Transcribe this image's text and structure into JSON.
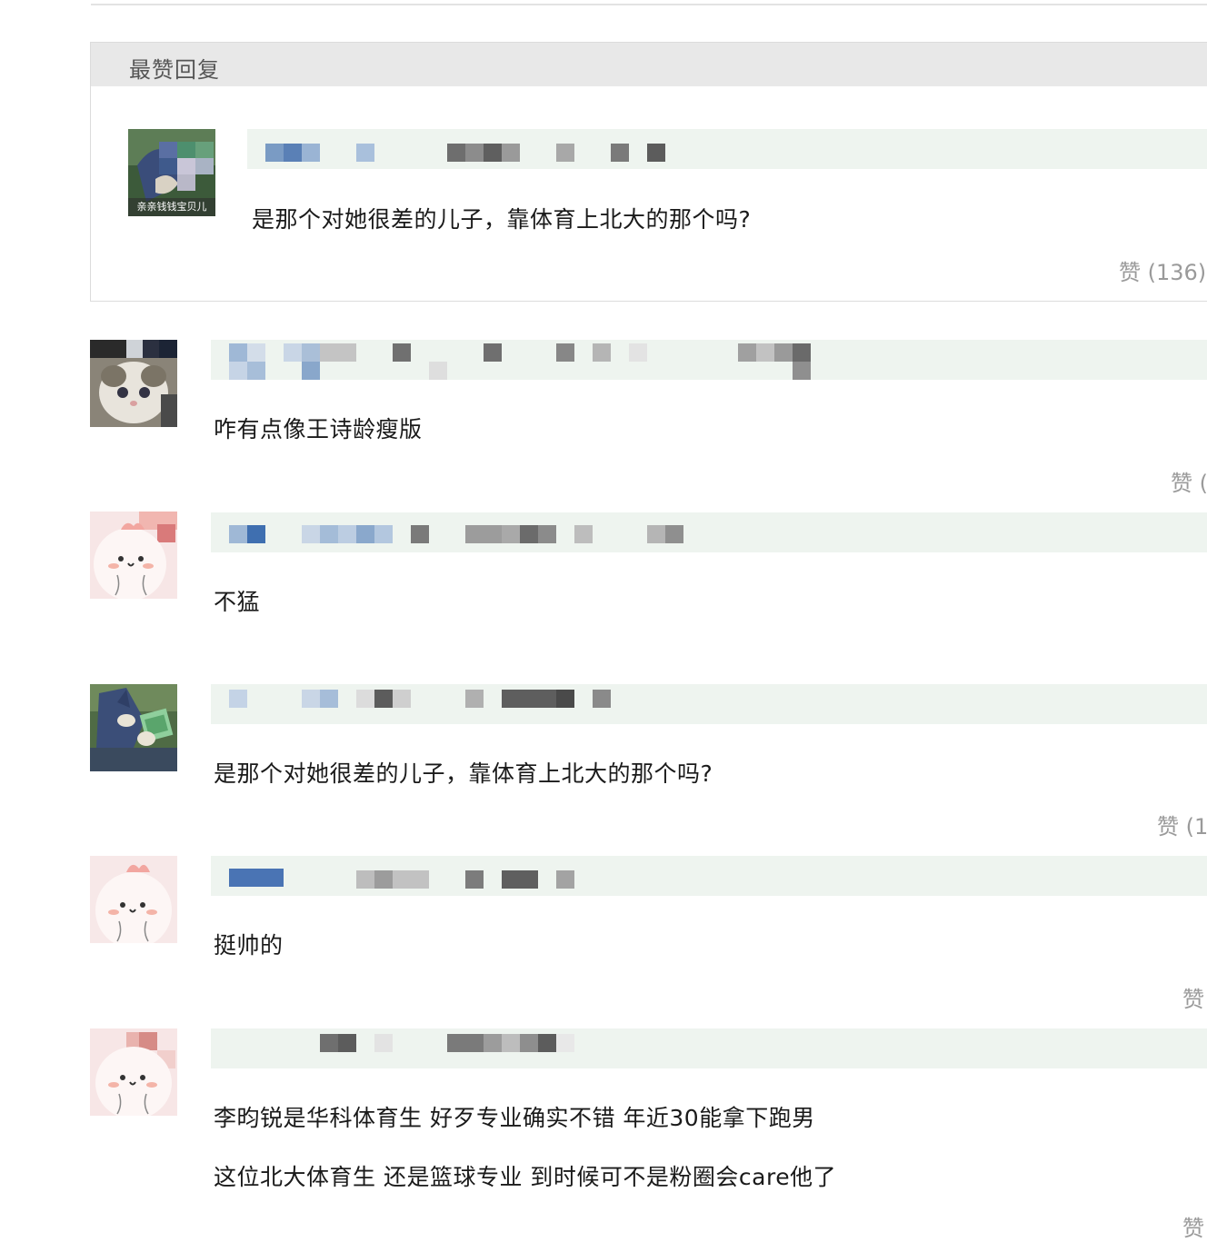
{
  "hot_section": {
    "title": "最赞回复",
    "comment": {
      "avatar_caption": "亲亲钱钱宝贝儿",
      "text": "是那个对她很差的儿子，靠体育上北大的那个吗?",
      "like_label": "赞 (136)"
    }
  },
  "comments": [
    {
      "text": "咋有点像王诗龄瘦版",
      "like_label": "赞 ("
    },
    {
      "text": "不猛",
      "like_label": ""
    },
    {
      "text": "是那个对她很差的儿子，靠体育上北大的那个吗?",
      "like_label": "赞 (1"
    },
    {
      "text": "挺帅的",
      "like_label": "赞"
    },
    {
      "text_line1": "李昀锐是华科体育生 好歹专业确实不错 年近30能拿下跑男",
      "text_line2": "这位北大体育生 还是篮球专业 到时候可不是粉圈会care他了",
      "like_label": "赞"
    }
  ],
  "colors": {
    "name_bar": "#eef4ef",
    "like": "#9a9a9a",
    "header_bg": "#e8e8e8"
  }
}
